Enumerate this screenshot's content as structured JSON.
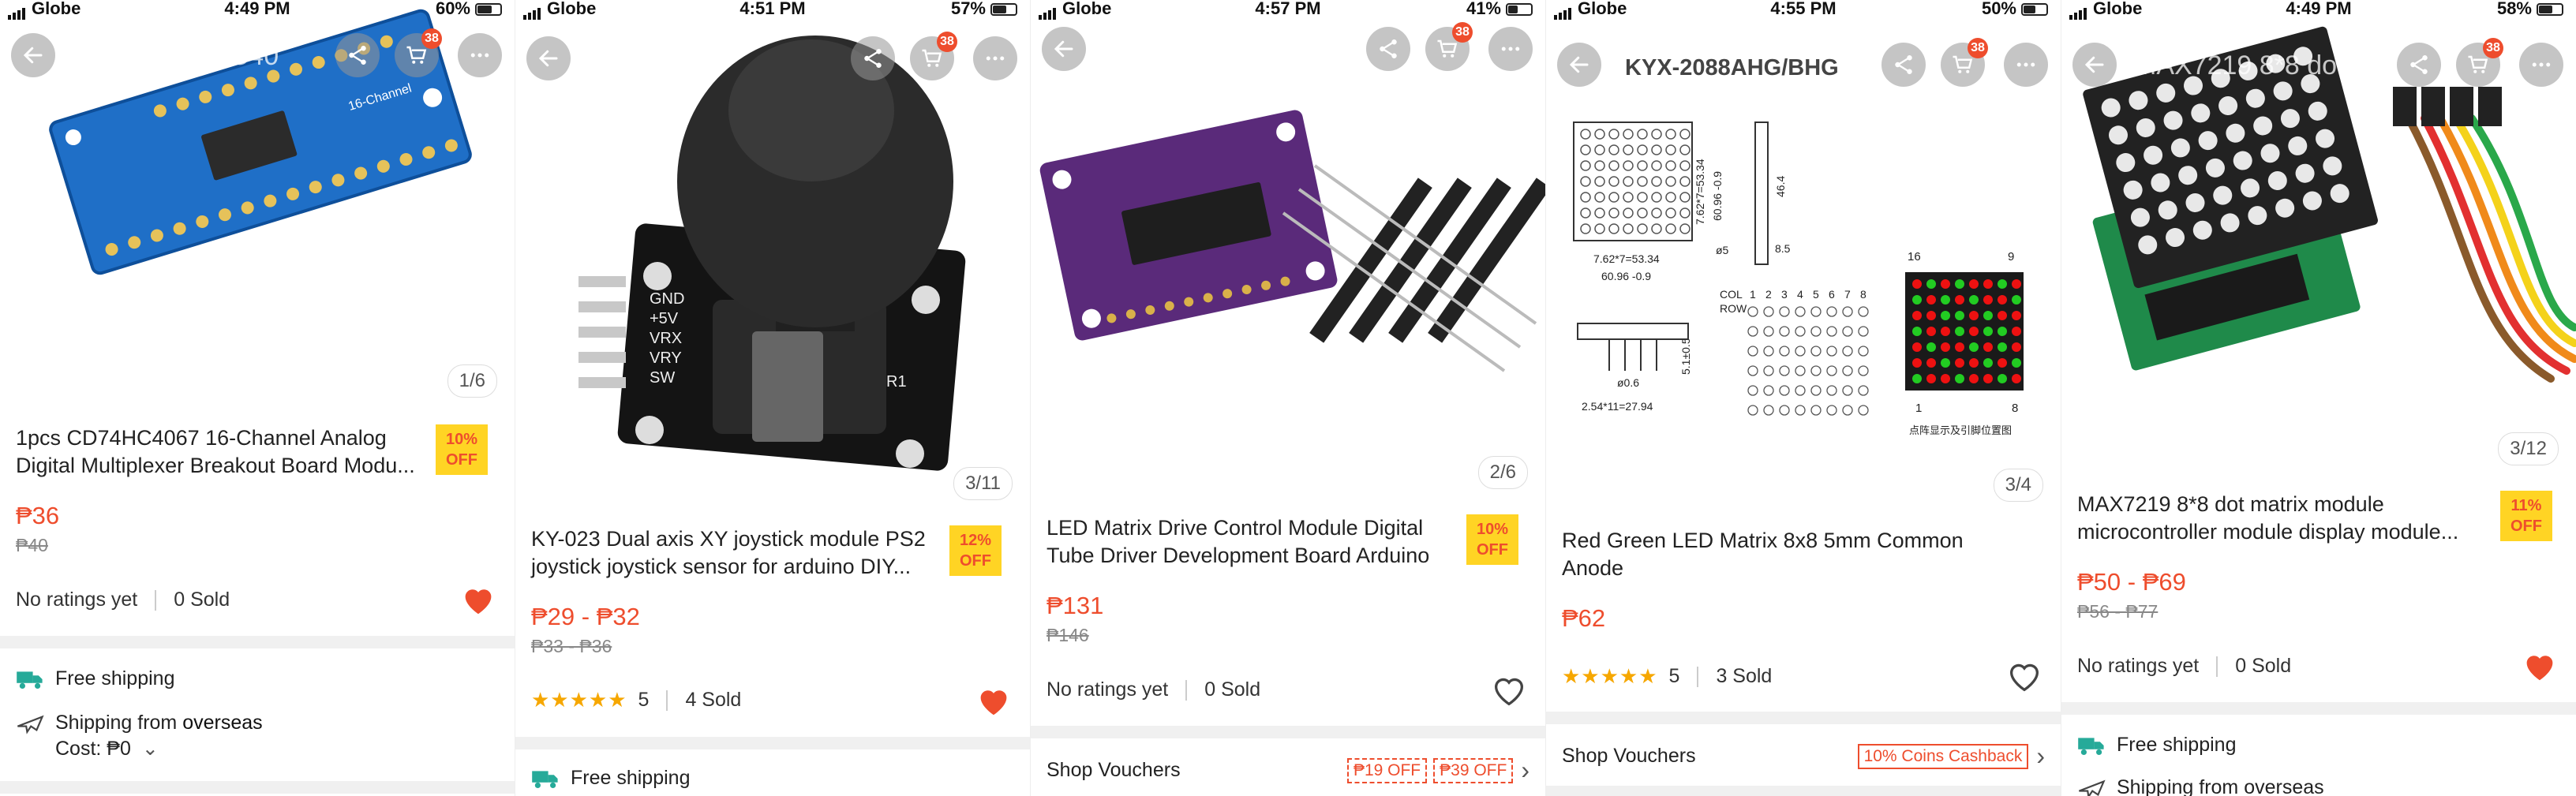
{
  "panels": [
    {
      "carrier": "Globe",
      "time": "4:49 PM",
      "battery": "60%",
      "cart_count": "38",
      "title": "1pcs CD74HC40",
      "counter": "1/6",
      "name": "1pcs CD74HC4067 16-Channel Analog Digital Multiplexer Breakout Board Modu...",
      "off_pct": "10%",
      "off_label": "OFF",
      "price": "₱36",
      "old_price": "₱40",
      "ratings": "No ratings yet",
      "sold": "0 Sold",
      "liked": true,
      "free_shipping": "Free shipping",
      "ship_from_prefix": "Shipping from",
      "ship_from": "overseas",
      "cost": "Cost: ₱0"
    },
    {
      "carrier": "Globe",
      "time": "4:51 PM",
      "battery": "57%",
      "cart_count": "38",
      "counter": "3/11",
      "name": "KY-023 Dual axis XY joystick module PS2 joystick joystick sensor for arduino DIY...",
      "off_pct": "12%",
      "off_label": "OFF",
      "price": "₱29 - ₱32",
      "old_price": "₱33 - ₱36",
      "rating_value": "5",
      "sold": "4 Sold",
      "liked": true,
      "free_shipping": "Free shipping",
      "board_labels": [
        "GND",
        "+5V",
        "VRX",
        "VRY",
        "SW"
      ],
      "board_ref": "R1"
    },
    {
      "carrier": "Globe",
      "time": "4:57 PM",
      "battery": "41%",
      "cart_count": "38",
      "counter": "2/6",
      "name": "LED Matrix Drive Control Module Digital Tube Driver Development Board Arduino",
      "off_pct": "10%",
      "off_label": "OFF",
      "price": "₱131",
      "old_price": "₱146",
      "ratings": "No ratings yet",
      "sold": "0 Sold",
      "liked": false,
      "vouchers_label": "Shop Vouchers",
      "vouchers": [
        "₱19 OFF",
        "₱39 OFF"
      ]
    },
    {
      "carrier": "Globe",
      "time": "4:55 PM",
      "battery": "50%",
      "cart_count": "38",
      "counter": "3/4",
      "brand": "KYX-2088AHG/BHG",
      "name": "Red Green LED Matrix 8x8 5mm Common Anode",
      "price": "₱62",
      "rating_value": "5",
      "sold": "3 Sold",
      "liked": false,
      "vouchers_label": "Shop Vouchers",
      "vouchers": [
        "10% Coins Cashback"
      ],
      "dims": [
        "7.62*7=53.34",
        "60.96 -0.9",
        "7.62*7=53.34",
        "60.96 -0.9",
        "46.4",
        "8.5",
        "ø5",
        "5.1±0.5",
        "ø0.6",
        "2.54*11=27.94"
      ],
      "col_label": "COL",
      "row_label": "ROW",
      "col_nums": [
        "1",
        "2",
        "3",
        "4",
        "5",
        "6",
        "7",
        "8"
      ],
      "pin_top": [
        "16",
        "9"
      ],
      "pin_bottom": [
        "1",
        "8"
      ],
      "caption": "点阵显示及引脚位置图"
    },
    {
      "carrier": "Globe",
      "time": "4:49 PM",
      "battery": "58%",
      "cart_count": "38",
      "title": "MAX7219 8*8 do...",
      "counter": "3/12",
      "name": "MAX7219 8*8 dot matrix module microcontroller module display module...",
      "off_pct": "11%",
      "off_label": "OFF",
      "price": "₱50 - ₱69",
      "old_price": "₱56 - ₱77",
      "ratings": "No ratings yet",
      "sold": "0 Sold",
      "liked": true,
      "free_shipping": "Free shipping",
      "ship_from_prefix": "Shipping from",
      "ship_from": "overseas"
    }
  ],
  "colors": {
    "accent": "#ee4d2d",
    "badge": "#ffd424",
    "teal": "#26aa99",
    "star": "#f6a700"
  },
  "icons": [
    "back-arrow-icon",
    "share-icon",
    "cart-icon",
    "more-icon",
    "heart-icon",
    "truck-icon",
    "plane-icon",
    "chevron-down-icon",
    "chevron-right-icon"
  ]
}
